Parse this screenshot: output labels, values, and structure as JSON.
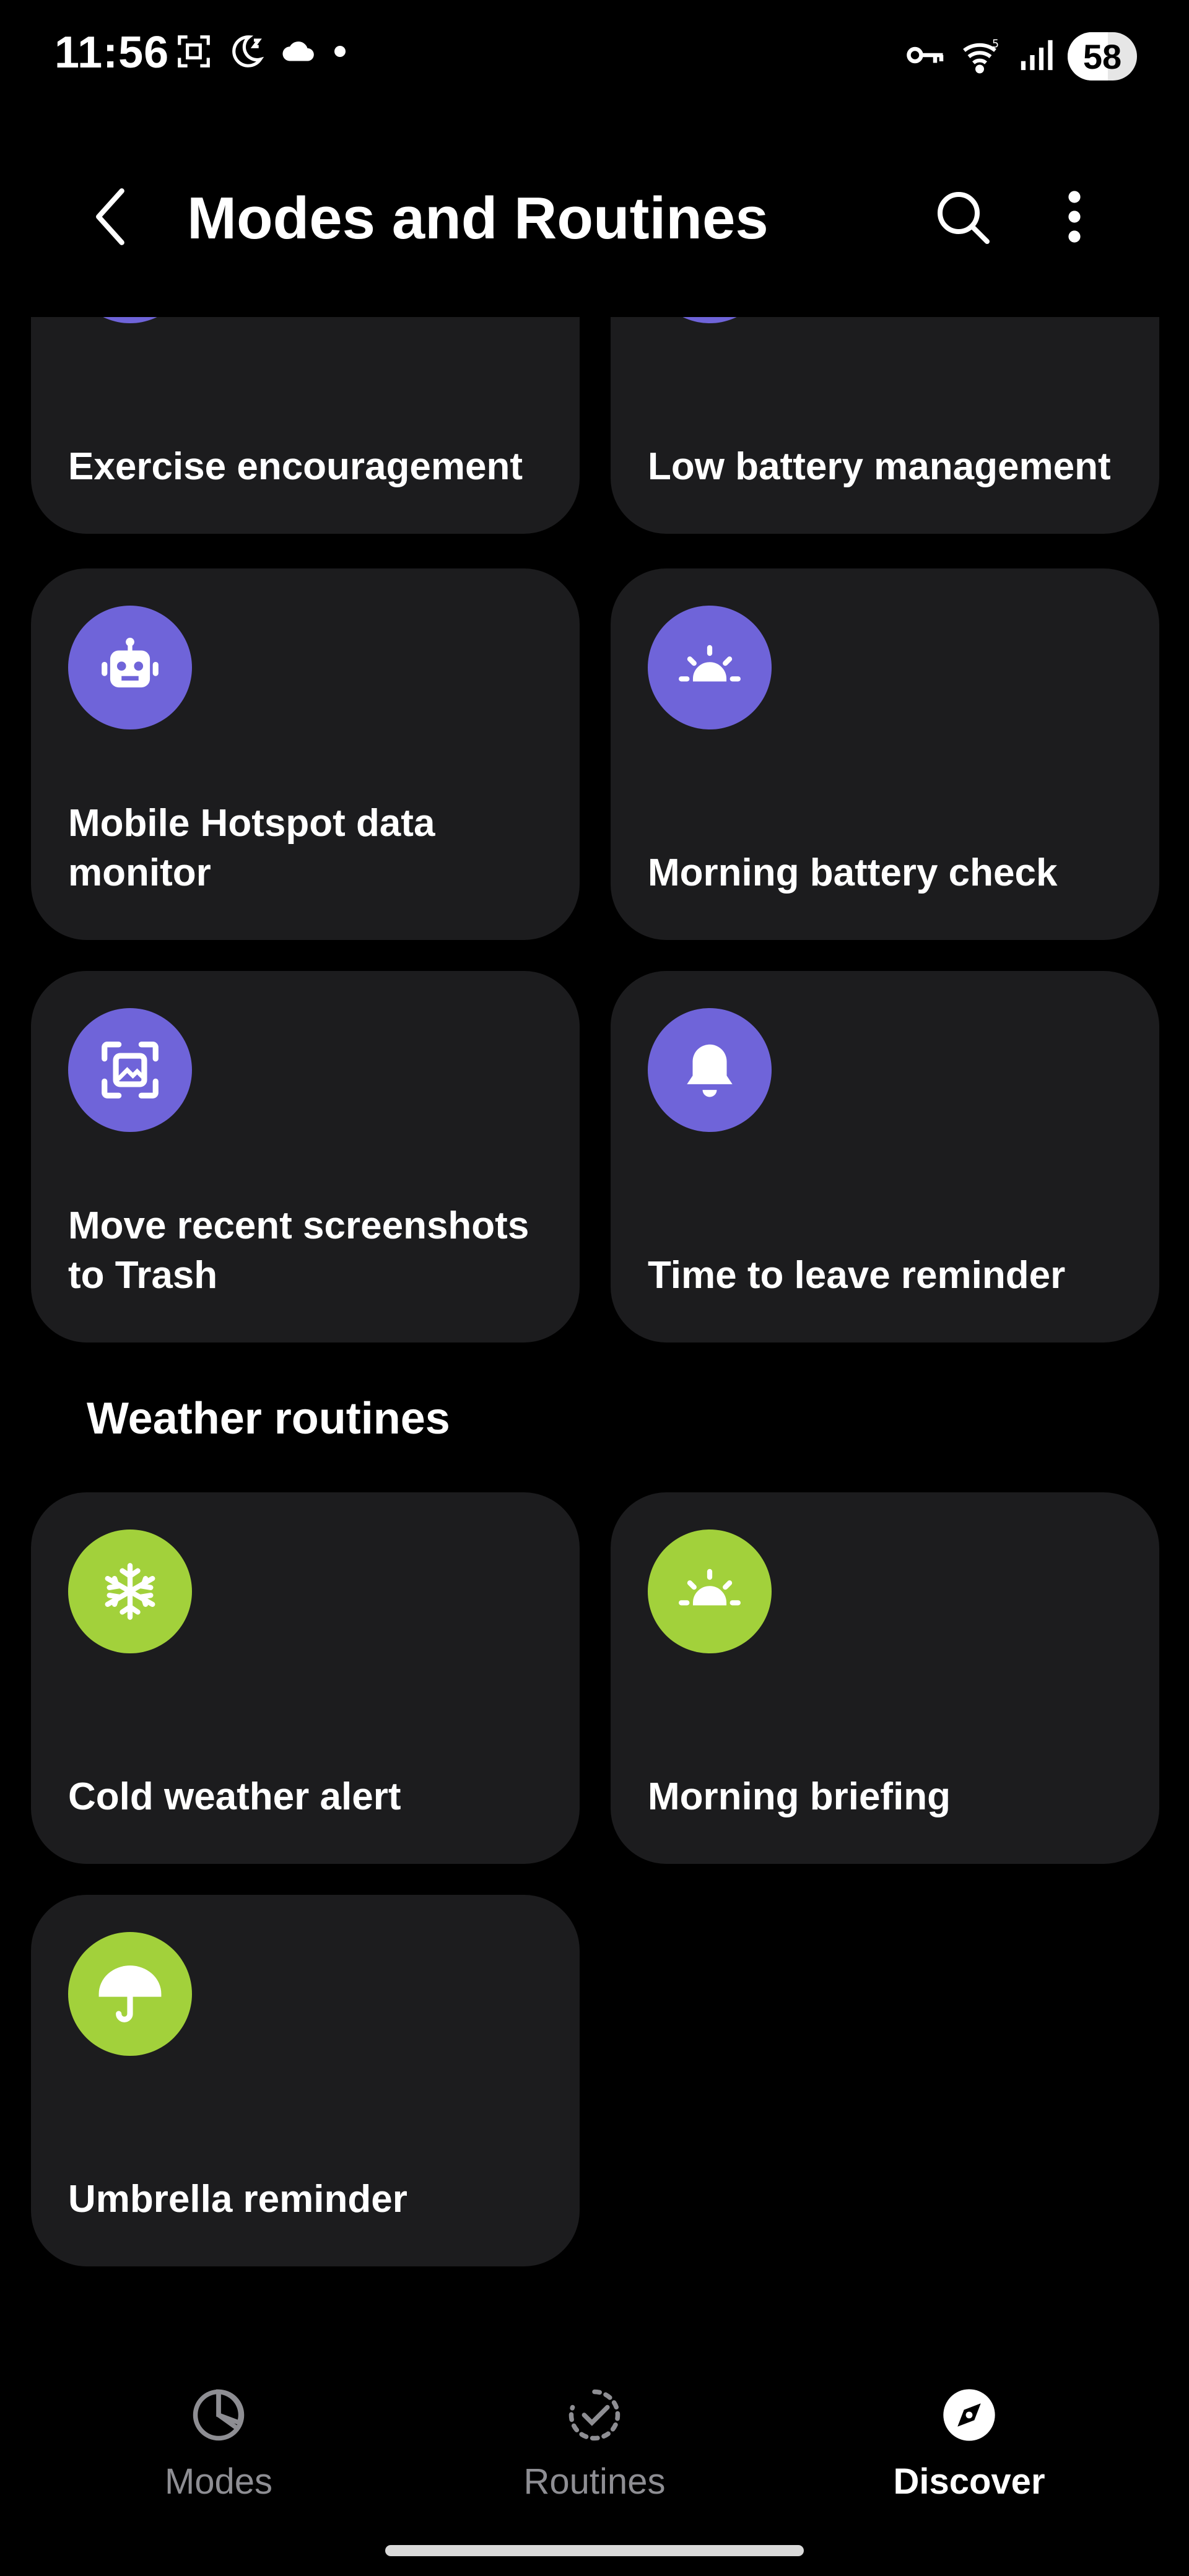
{
  "status_bar": {
    "time": "11:56",
    "battery_level": "58",
    "battery_fraction": 0.58
  },
  "app_bar": {
    "title": "Modes and Routines"
  },
  "cards": [
    {
      "label": "Exercise encouragement",
      "icon": "exercise-icon",
      "color": "#6f64d9"
    },
    {
      "label": "Low battery management",
      "icon": "battery-icon",
      "color": "#6f64d9"
    },
    {
      "label": "Mobile Hotspot data monitor",
      "icon": "robot-icon",
      "color": "#6f64d9"
    },
    {
      "label": "Morning battery check",
      "icon": "sunrise-icon",
      "color": "#6f64d9"
    },
    {
      "label": "Move recent screenshots to Trash",
      "icon": "screenshot-icon",
      "color": "#6f64d9"
    },
    {
      "label": "Time to leave reminder",
      "icon": "bell-icon",
      "color": "#6f64d9"
    }
  ],
  "weather_section": {
    "title": "Weather routines",
    "cards": [
      {
        "label": "Cold weather alert",
        "icon": "snowflake-icon",
        "color": "#a2d13b"
      },
      {
        "label": "Morning briefing",
        "icon": "sunrise-icon",
        "color": "#a2d13b"
      },
      {
        "label": "Umbrella reminder",
        "icon": "umbrella-icon",
        "color": "#a2d13b"
      }
    ]
  },
  "bottom_nav": {
    "items": [
      {
        "label": "Modes",
        "icon": "modes-icon",
        "active": false
      },
      {
        "label": "Routines",
        "icon": "routines-icon",
        "active": false
      },
      {
        "label": "Discover",
        "icon": "compass-icon",
        "active": true
      }
    ]
  }
}
